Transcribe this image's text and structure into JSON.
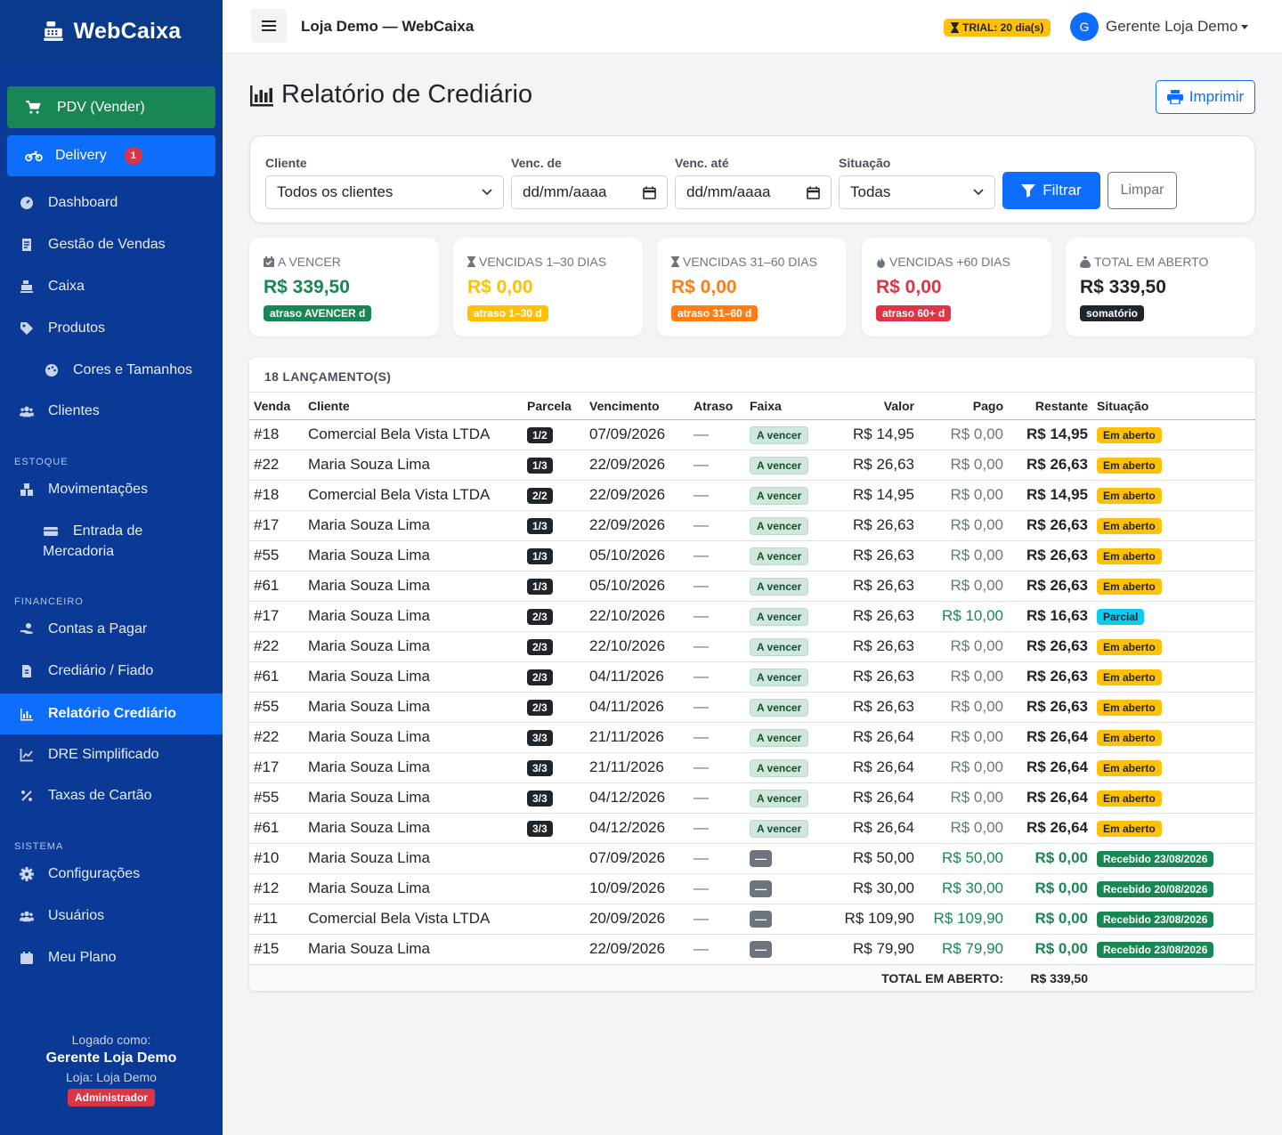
{
  "brand": {
    "name": "WebCaixa"
  },
  "sidebar": {
    "pdv_label": "PDV (Vender)",
    "delivery_label": "Delivery",
    "delivery_badge": "1",
    "items": [
      {
        "label": "Dashboard"
      },
      {
        "label": "Gestão de Vendas"
      },
      {
        "label": "Caixa"
      },
      {
        "label": "Produtos"
      },
      {
        "label": "Cores e Tamanhos"
      },
      {
        "label": "Clientes"
      }
    ],
    "section_estoque": "ESTOQUE",
    "estoque_items": [
      {
        "label": "Movimentações"
      },
      {
        "label_l1": "Entrada de",
        "label_l2": "Mercadoria"
      }
    ],
    "section_financeiro": "FINANCEIRO",
    "financeiro_items": [
      {
        "label": "Contas a Pagar"
      },
      {
        "label": "Crediário / Fiado"
      },
      {
        "label": "Relatório Crediário"
      },
      {
        "label": "DRE Simplificado"
      },
      {
        "label": "Taxas de Cartão"
      }
    ],
    "section_sistema": "SISTEMA",
    "sistema_items": [
      {
        "label": "Configurações"
      },
      {
        "label": "Usuários"
      },
      {
        "label": "Meu Plano"
      }
    ],
    "footer": {
      "logged_as": "Logado como:",
      "user": "Gerente Loja Demo",
      "store": "Loja: Loja Demo",
      "role": "Administrador"
    }
  },
  "topbar": {
    "title": "Loja Demo — WebCaixa",
    "trial": "TRIAL: 20 dia(s)",
    "avatar_initial": "G",
    "user_name": "Gerente Loja Demo"
  },
  "page": {
    "title": "Relatório de Crediário",
    "print_label": "Imprimir"
  },
  "filters": {
    "cliente_label": "Cliente",
    "cliente_value": "Todos os clientes",
    "venc_de_label": "Venc. de",
    "venc_de_placeholder": "dd/mm/aaaa",
    "venc_ate_label": "Venc. até",
    "venc_ate_placeholder": "dd/mm/aaaa",
    "situacao_label": "Situação",
    "situacao_value": "Todas",
    "filter_button": "Filtrar",
    "clear_button": "Limpar"
  },
  "summary": [
    {
      "title": "A VENCER",
      "value": "R$ 339,50",
      "badge": "atraso AVENCER d",
      "color": "#198754",
      "badge_bg": "#198754",
      "badge_fg": "#ffffff"
    },
    {
      "title": "VENCIDAS 1–30 DIAS",
      "value": "R$ 0,00",
      "badge": "atraso 1–30 d",
      "color": "#ffc107",
      "badge_bg": "#ffc107",
      "badge_fg": "#ffffff"
    },
    {
      "title": "VENCIDAS 31–60 DIAS",
      "value": "R$ 0,00",
      "badge": "atraso 31–60 d",
      "color": "#fd7e14",
      "badge_bg": "#fd7e14",
      "badge_fg": "#ffffff"
    },
    {
      "title": "VENCIDAS +60 DIAS",
      "value": "R$ 0,00",
      "badge": "atraso 60+ d",
      "color": "#dc3545",
      "badge_bg": "#dc3545",
      "badge_fg": "#ffffff"
    },
    {
      "title": "TOTAL EM ABERTO",
      "value": "R$ 339,50",
      "badge": "somatório",
      "color": "#212529",
      "badge_bg": "#212529",
      "badge_fg": "#ffffff"
    }
  ],
  "table": {
    "count_label": "18 LANÇAMENTO(S)",
    "headers": [
      "Venda",
      "Cliente",
      "Parcela",
      "Vencimento",
      "Atraso",
      "Faixa",
      "Valor",
      "Pago",
      "Restante",
      "Situação"
    ],
    "rows": [
      {
        "venda": "#18",
        "cliente": "Comercial Bela Vista LTDA",
        "parcela": "1/2",
        "vencimento": "07/09/2026",
        "atraso": "—",
        "faixa": "A vencer",
        "valor": "R$ 14,95",
        "pago": "R$ 0,00",
        "restante": "R$ 14,95",
        "situacao": "Em aberto",
        "sit_type": "warn"
      },
      {
        "venda": "#22",
        "cliente": "Maria Souza Lima",
        "parcela": "1/3",
        "vencimento": "22/09/2026",
        "atraso": "—",
        "faixa": "A vencer",
        "valor": "R$ 26,63",
        "pago": "R$ 0,00",
        "restante": "R$ 26,63",
        "situacao": "Em aberto",
        "sit_type": "warn"
      },
      {
        "venda": "#18",
        "cliente": "Comercial Bela Vista LTDA",
        "parcela": "2/2",
        "vencimento": "22/09/2026",
        "atraso": "—",
        "faixa": "A vencer",
        "valor": "R$ 14,95",
        "pago": "R$ 0,00",
        "restante": "R$ 14,95",
        "situacao": "Em aberto",
        "sit_type": "warn"
      },
      {
        "venda": "#17",
        "cliente": "Maria Souza Lima",
        "parcela": "1/3",
        "vencimento": "22/09/2026",
        "atraso": "—",
        "faixa": "A vencer",
        "valor": "R$ 26,63",
        "pago": "R$ 0,00",
        "restante": "R$ 26,63",
        "situacao": "Em aberto",
        "sit_type": "warn"
      },
      {
        "venda": "#55",
        "cliente": "Maria Souza Lima",
        "parcela": "1/3",
        "vencimento": "05/10/2026",
        "atraso": "—",
        "faixa": "A vencer",
        "valor": "R$ 26,63",
        "pago": "R$ 0,00",
        "restante": "R$ 26,63",
        "situacao": "Em aberto",
        "sit_type": "warn"
      },
      {
        "venda": "#61",
        "cliente": "Maria Souza Lima",
        "parcela": "1/3",
        "vencimento": "05/10/2026",
        "atraso": "—",
        "faixa": "A vencer",
        "valor": "R$ 26,63",
        "pago": "R$ 0,00",
        "restante": "R$ 26,63",
        "situacao": "Em aberto",
        "sit_type": "warn"
      },
      {
        "venda": "#17",
        "cliente": "Maria Souza Lima",
        "parcela": "2/3",
        "vencimento": "22/10/2026",
        "atraso": "—",
        "faixa": "A vencer",
        "valor": "R$ 26,63",
        "pago": "R$ 10,00",
        "restante": "R$ 16,63",
        "situacao": "Parcial",
        "sit_type": "info"
      },
      {
        "venda": "#22",
        "cliente": "Maria Souza Lima",
        "parcela": "2/3",
        "vencimento": "22/10/2026",
        "atraso": "—",
        "faixa": "A vencer",
        "valor": "R$ 26,63",
        "pago": "R$ 0,00",
        "restante": "R$ 26,63",
        "situacao": "Em aberto",
        "sit_type": "warn"
      },
      {
        "venda": "#61",
        "cliente": "Maria Souza Lima",
        "parcela": "2/3",
        "vencimento": "04/11/2026",
        "atraso": "—",
        "faixa": "A vencer",
        "valor": "R$ 26,63",
        "pago": "R$ 0,00",
        "restante": "R$ 26,63",
        "situacao": "Em aberto",
        "sit_type": "warn"
      },
      {
        "venda": "#55",
        "cliente": "Maria Souza Lima",
        "parcela": "2/3",
        "vencimento": "04/11/2026",
        "atraso": "—",
        "faixa": "A vencer",
        "valor": "R$ 26,63",
        "pago": "R$ 0,00",
        "restante": "R$ 26,63",
        "situacao": "Em aberto",
        "sit_type": "warn"
      },
      {
        "venda": "#22",
        "cliente": "Maria Souza Lima",
        "parcela": "3/3",
        "vencimento": "21/11/2026",
        "atraso": "—",
        "faixa": "A vencer",
        "valor": "R$ 26,64",
        "pago": "R$ 0,00",
        "restante": "R$ 26,64",
        "situacao": "Em aberto",
        "sit_type": "warn"
      },
      {
        "venda": "#17",
        "cliente": "Maria Souza Lima",
        "parcela": "3/3",
        "vencimento": "21/11/2026",
        "atraso": "—",
        "faixa": "A vencer",
        "valor": "R$ 26,64",
        "pago": "R$ 0,00",
        "restante": "R$ 26,64",
        "situacao": "Em aberto",
        "sit_type": "warn"
      },
      {
        "venda": "#55",
        "cliente": "Maria Souza Lima",
        "parcela": "3/3",
        "vencimento": "04/12/2026",
        "atraso": "—",
        "faixa": "A vencer",
        "valor": "R$ 26,64",
        "pago": "R$ 0,00",
        "restante": "R$ 26,64",
        "situacao": "Em aberto",
        "sit_type": "warn"
      },
      {
        "venda": "#61",
        "cliente": "Maria Souza Lima",
        "parcela": "3/3",
        "vencimento": "04/12/2026",
        "atraso": "—",
        "faixa": "A vencer",
        "valor": "R$ 26,64",
        "pago": "R$ 0,00",
        "restante": "R$ 26,64",
        "situacao": "Em aberto",
        "sit_type": "warn"
      },
      {
        "venda": "#10",
        "cliente": "Maria Souza Lima",
        "parcela": "",
        "vencimento": "07/09/2026",
        "atraso": "—",
        "faixa": "—",
        "valor": "R$ 50,00",
        "pago": "R$ 50,00",
        "restante": "R$ 0,00",
        "situacao": "Recebido 23/08/2026",
        "sit_type": "ok"
      },
      {
        "venda": "#12",
        "cliente": "Maria Souza Lima",
        "parcela": "",
        "vencimento": "10/09/2026",
        "atraso": "—",
        "faixa": "—",
        "valor": "R$ 30,00",
        "pago": "R$ 30,00",
        "restante": "R$ 0,00",
        "situacao": "Recebido 20/08/2026",
        "sit_type": "ok"
      },
      {
        "venda": "#11",
        "cliente": "Comercial Bela Vista LTDA",
        "parcela": "",
        "vencimento": "20/09/2026",
        "atraso": "—",
        "faixa": "—",
        "valor": "R$ 109,90",
        "pago": "R$ 109,90",
        "restante": "R$ 0,00",
        "situacao": "Recebido 23/08/2026",
        "sit_type": "ok"
      },
      {
        "venda": "#15",
        "cliente": "Maria Souza Lima",
        "parcela": "",
        "vencimento": "22/09/2026",
        "atraso": "—",
        "faixa": "—",
        "valor": "R$ 79,90",
        "pago": "R$ 79,90",
        "restante": "R$ 0,00",
        "situacao": "Recebido 23/08/2026",
        "sit_type": "ok"
      }
    ],
    "footer_label": "TOTAL EM ABERTO:",
    "footer_value": "R$ 339,50"
  }
}
